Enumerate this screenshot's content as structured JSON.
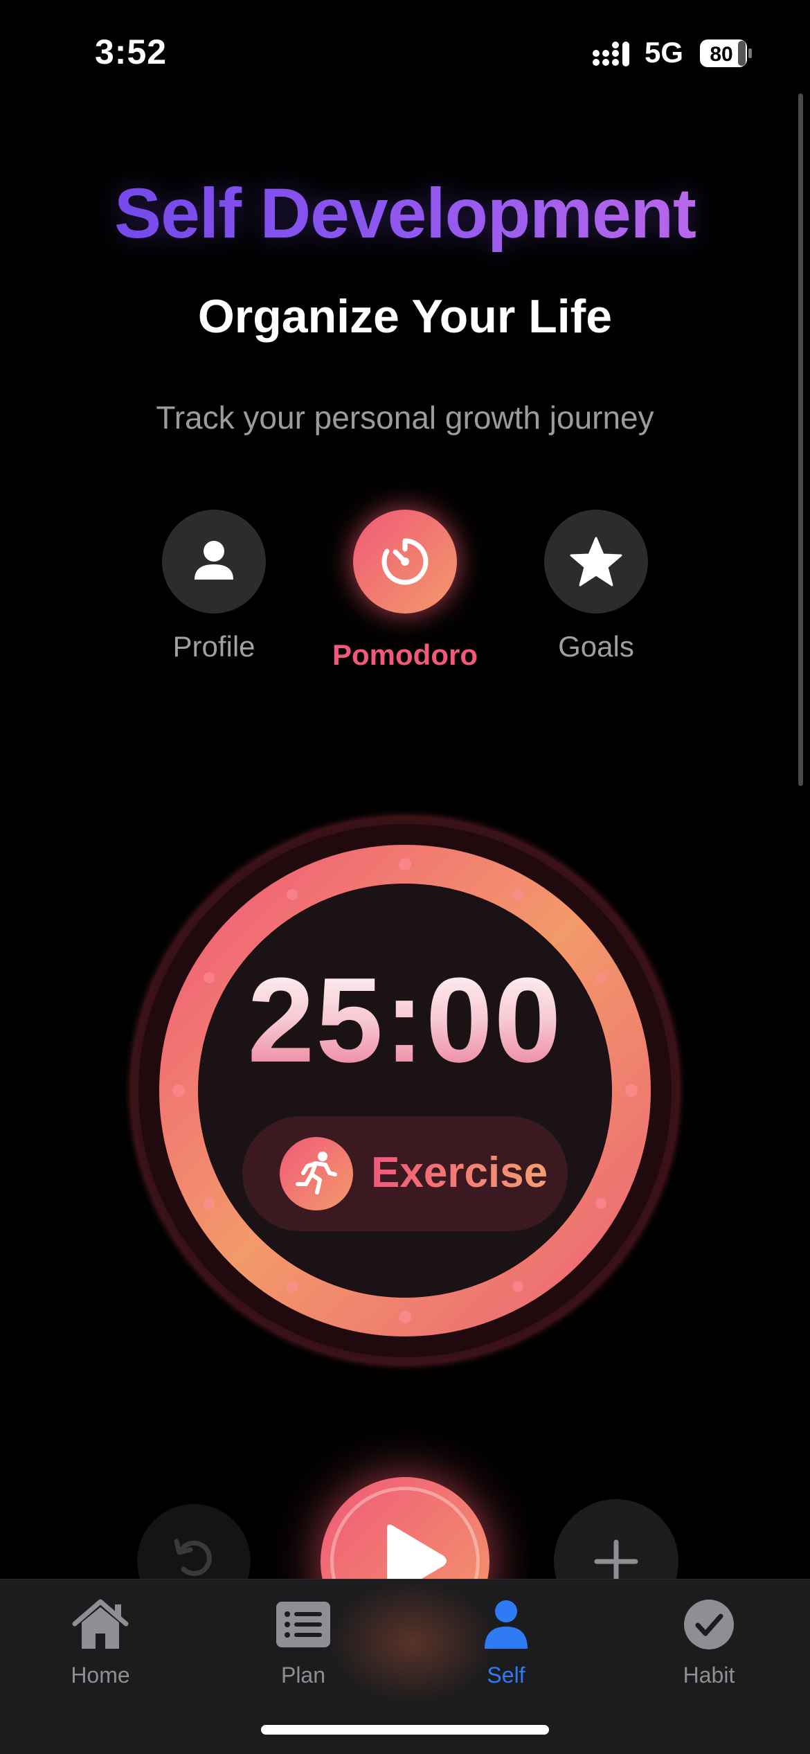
{
  "status_bar": {
    "time": "3:52",
    "network": "5G",
    "battery": "80"
  },
  "header": {
    "title": "Self Development",
    "subtitle": "Organize Your Life",
    "tagline": "Track your personal growth journey"
  },
  "modes": {
    "profile": {
      "label": "Profile",
      "icon": "person-icon"
    },
    "pomodoro": {
      "label": "Pomodoro",
      "icon": "timer-icon",
      "selected": true
    },
    "goals": {
      "label": "Goals",
      "icon": "star-icon"
    }
  },
  "timer": {
    "display": "25:00",
    "category": {
      "label": "Exercise",
      "icon": "running-icon"
    }
  },
  "controls": {
    "reset_icon": "reset-icon",
    "play_icon": "play-icon",
    "add_icon": "plus-icon"
  },
  "tab_bar": {
    "items": [
      {
        "label": "Home",
        "icon": "house-icon"
      },
      {
        "label": "Plan",
        "icon": "list-icon"
      },
      {
        "label": "Self",
        "icon": "person-icon",
        "active": true
      },
      {
        "label": "Habit",
        "icon": "checkmark-icon"
      }
    ]
  },
  "colors": {
    "accent_start": "#f05a78",
    "accent_end": "#f29a6a",
    "title_start": "#6b44e8",
    "title_end": "#c86ee8",
    "active_tab": "#2f7bf5"
  }
}
